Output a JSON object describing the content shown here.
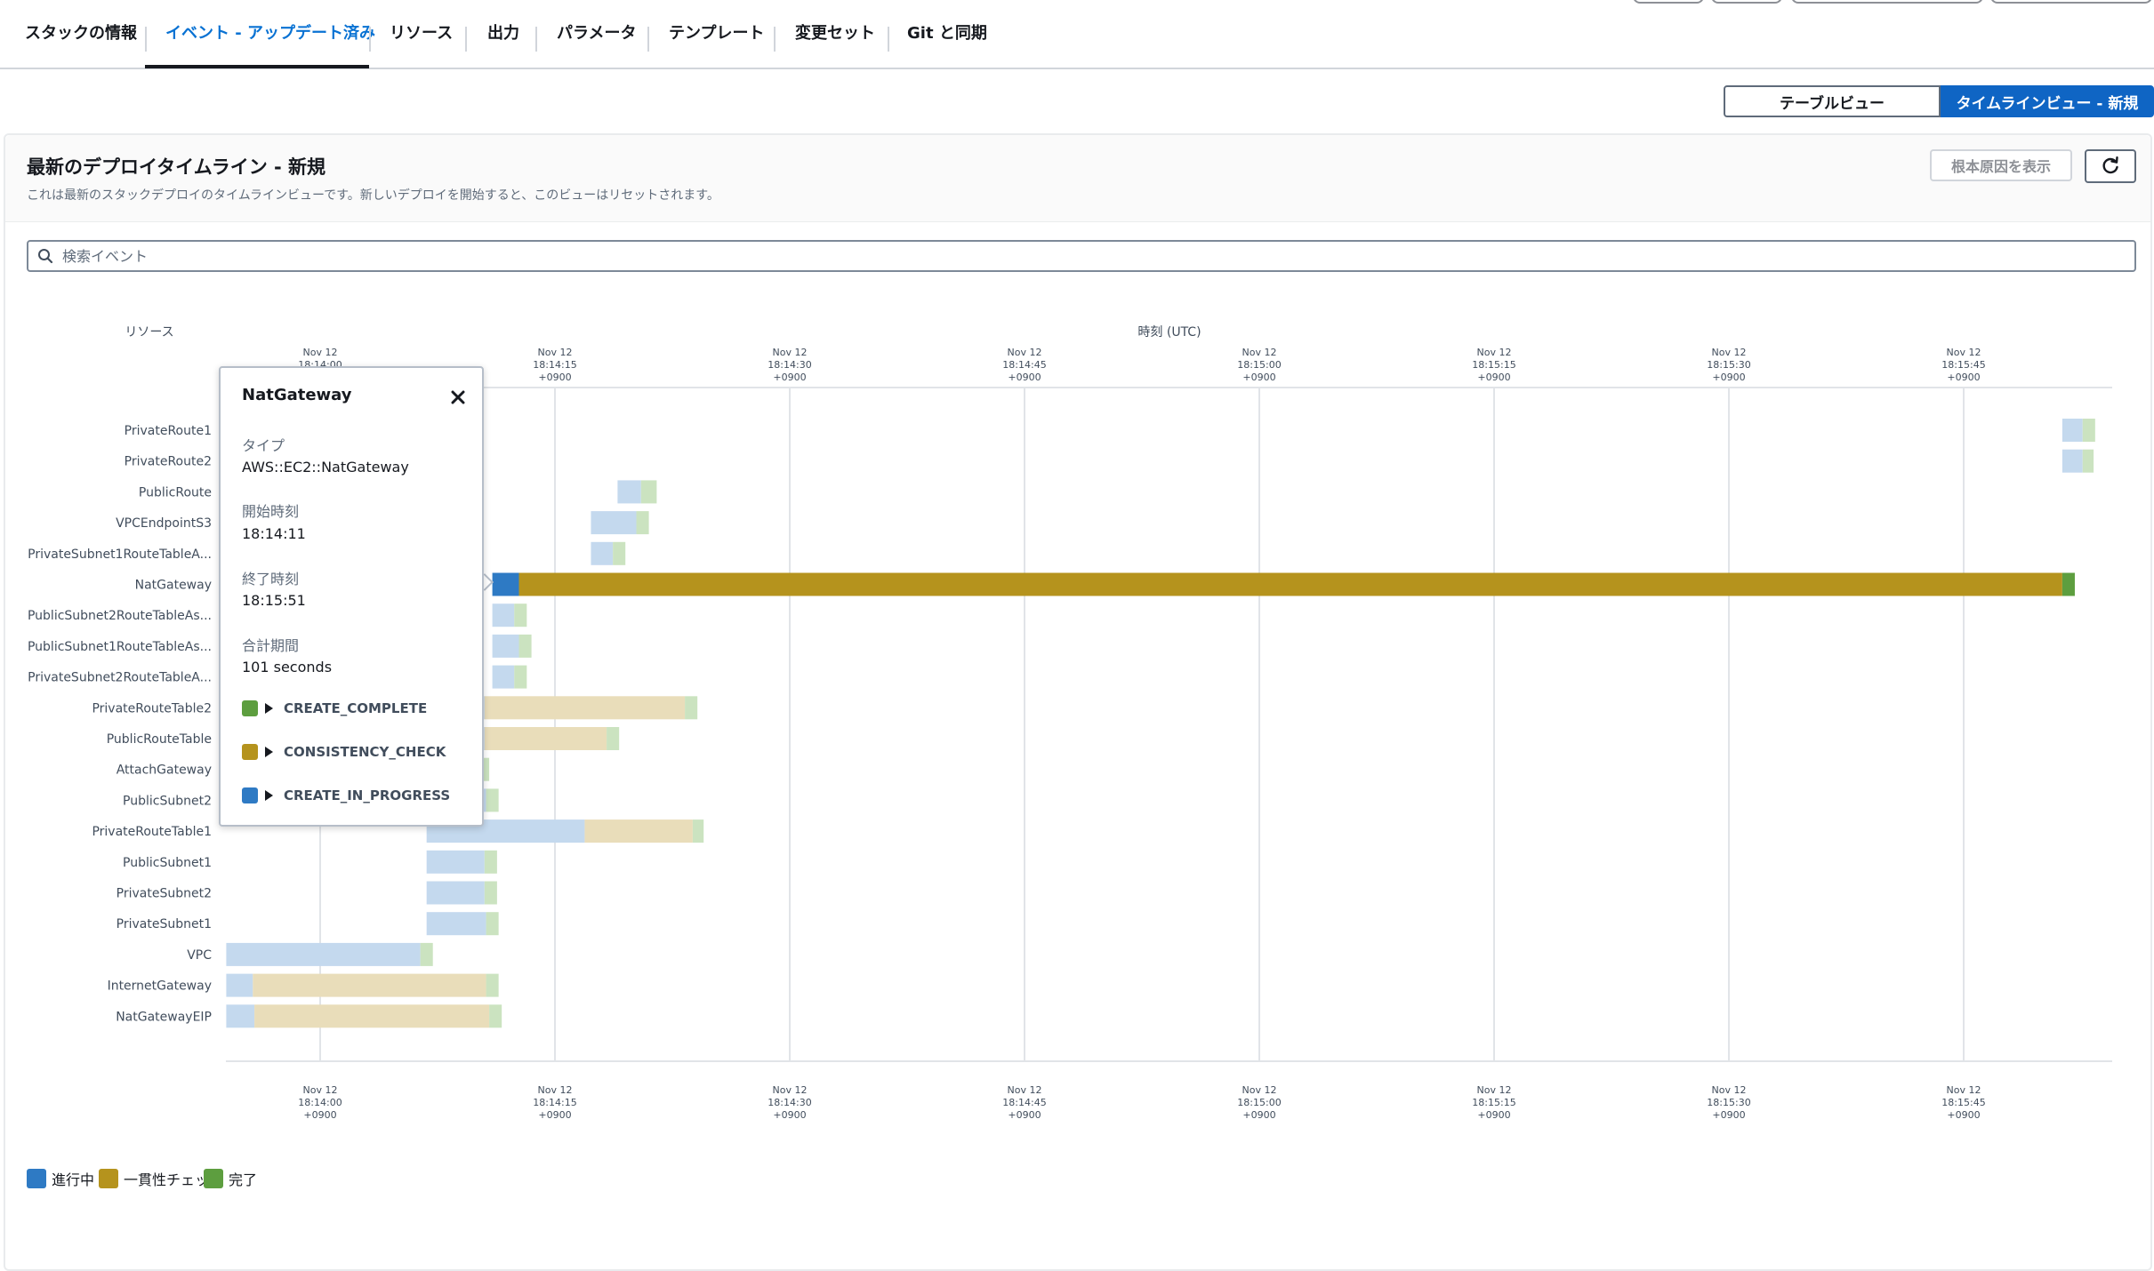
{
  "tabs": [
    {
      "label": "スタックの情報"
    },
    {
      "label": "イベント - アップデート済み",
      "active": true
    },
    {
      "label": "リソース"
    },
    {
      "label": "出力"
    },
    {
      "label": "パラメータ"
    },
    {
      "label": "テンプレート"
    },
    {
      "label": "変更セット"
    },
    {
      "label": "Git と同期"
    }
  ],
  "view_toggle": {
    "table": "テーブルビュー",
    "timeline": "タイムラインビュー - 新規"
  },
  "panel": {
    "title": "最新のデプロイタイムライン - 新規",
    "description": "これは最新のスタックデプロイのタイムラインビューです。新しいデプロイを開始すると、このビューはリセットされます。",
    "root_cause_button": "根本原因を表示",
    "refresh_icon": "refresh-icon"
  },
  "search": {
    "placeholder": "検索イベント",
    "value": "",
    "icon": "search-icon"
  },
  "colors": {
    "in_progress": "#2e7ac4",
    "consistency_check": "#b5931d",
    "complete": "#5d9e3f",
    "in_progress_faded": "#c4d9ee",
    "consistency_check_faded": "#e9ddba",
    "complete_faded": "#cbe3c0"
  },
  "legend": [
    {
      "label": "進行中",
      "color": "#2e7ac4"
    },
    {
      "label": "一貫性チェック",
      "color": "#b5931d"
    },
    {
      "label": "完了",
      "color": "#5d9e3f"
    }
  ],
  "popover": {
    "title": "NatGateway",
    "type_label": "タイプ",
    "type_value": "AWS::EC2::NatGateway",
    "start_label": "開始時刻",
    "start_value": "18:14:11",
    "end_label": "終了時刻",
    "end_value": "18:15:51",
    "duration_label": "合計期間",
    "duration_value": "101 seconds",
    "statuses": [
      {
        "label": "CREATE_COMPLETE",
        "color": "#5d9e3f"
      },
      {
        "label": "CONSISTENCY_CHECK",
        "color": "#b5931d"
      },
      {
        "label": "CREATE_IN_PROGRESS",
        "color": "#2e7ac4"
      }
    ]
  },
  "chart_data": {
    "type": "timeline",
    "ylabel": "リソース",
    "xlabel": "時刻 (UTC)",
    "x_unit": "seconds after 18:14:00 +0900",
    "xlim": [
      -4,
      76.4
    ],
    "ticks": [
      {
        "date": "Nov 12",
        "time": "18:14:00",
        "tz": "+0900",
        "value": 0
      },
      {
        "date": "Nov 12",
        "time": "18:14:15",
        "tz": "+0900",
        "value": 15
      },
      {
        "date": "Nov 12",
        "time": "18:14:30",
        "tz": "+0900",
        "value": 30
      },
      {
        "date": "Nov 12",
        "time": "18:14:45",
        "tz": "+0900",
        "value": 45
      },
      {
        "date": "Nov 12",
        "time": "18:15:00",
        "tz": "+0900",
        "value": 60
      },
      {
        "date": "Nov 12",
        "time": "18:15:15",
        "tz": "+0900",
        "value": 75
      },
      {
        "date": "Nov 12",
        "time": "18:15:30",
        "tz": "+0900",
        "value": 90
      },
      {
        "date": "Nov 12",
        "time": "18:15:45",
        "tz": "+0900",
        "value": 105
      }
    ],
    "highlighted": "NatGateway",
    "resources": [
      {
        "name": "PrivateRoute1",
        "segments": [
          {
            "s": "in_progress",
            "from": 111.3,
            "to": 112.6
          },
          {
            "s": "complete",
            "from": 112.6,
            "to": 113.4
          }
        ]
      },
      {
        "name": "PrivateRoute2",
        "segments": [
          {
            "s": "in_progress",
            "from": 111.3,
            "to": 112.6
          },
          {
            "s": "complete",
            "from": 112.6,
            "to": 113.3
          }
        ]
      },
      {
        "name": "PublicRoute",
        "segments": [
          {
            "s": "in_progress",
            "from": 19.0,
            "to": 20.5
          },
          {
            "s": "complete",
            "from": 20.5,
            "to": 21.5
          }
        ]
      },
      {
        "name": "VPCEndpointS3",
        "segments": [
          {
            "s": "in_progress",
            "from": 17.3,
            "to": 20.2
          },
          {
            "s": "complete",
            "from": 20.2,
            "to": 21.0
          }
        ]
      },
      {
        "name": "PrivateSubnet1RouteTableA...",
        "segments": [
          {
            "s": "in_progress",
            "from": 17.3,
            "to": 18.7
          },
          {
            "s": "complete",
            "from": 18.7,
            "to": 19.5
          }
        ]
      },
      {
        "name": "NatGateway",
        "segments": [
          {
            "s": "in_progress",
            "from": 11.0,
            "to": 12.7
          },
          {
            "s": "consistency_check",
            "from": 12.7,
            "to": 111.3
          },
          {
            "s": "complete",
            "from": 111.3,
            "to": 112.1
          }
        ]
      },
      {
        "name": "PublicSubnet2RouteTableAs...",
        "segments": [
          {
            "s": "in_progress",
            "from": 11.0,
            "to": 12.4
          },
          {
            "s": "complete",
            "from": 12.4,
            "to": 13.2
          }
        ]
      },
      {
        "name": "PublicSubnet1RouteTableAs...",
        "segments": [
          {
            "s": "in_progress",
            "from": 11.0,
            "to": 12.7
          },
          {
            "s": "complete",
            "from": 12.7,
            "to": 13.5
          }
        ]
      },
      {
        "name": "PrivateSubnet2RouteTableA...",
        "segments": [
          {
            "s": "in_progress",
            "from": 11.0,
            "to": 12.4
          },
          {
            "s": "complete",
            "from": 12.4,
            "to": 13.2
          }
        ]
      },
      {
        "name": "PrivateRouteTable2",
        "segments": [
          {
            "s": "in_progress",
            "from": 7.5,
            "to": 10.5
          },
          {
            "s": "consistency_check",
            "from": 10.5,
            "to": 23.3
          },
          {
            "s": "complete",
            "from": 23.3,
            "to": 24.1
          }
        ]
      },
      {
        "name": "PublicRouteTable",
        "segments": [
          {
            "s": "in_progress",
            "from": 7.5,
            "to": 10.5
          },
          {
            "s": "consistency_check",
            "from": 10.5,
            "to": 18.3
          },
          {
            "s": "complete",
            "from": 18.3,
            "to": 19.1
          }
        ]
      },
      {
        "name": "AttachGateway",
        "segments": [
          {
            "s": "in_progress",
            "from": 7.5,
            "to": 10.0
          },
          {
            "s": "complete",
            "from": 10.0,
            "to": 10.8
          }
        ]
      },
      {
        "name": "PublicSubnet2",
        "segments": [
          {
            "s": "in_progress",
            "from": 7.5,
            "to": 10.6
          },
          {
            "s": "complete",
            "from": 10.6,
            "to": 11.4
          }
        ]
      },
      {
        "name": "PrivateRouteTable1",
        "segments": [
          {
            "s": "in_progress",
            "from": 6.8,
            "to": 16.9
          },
          {
            "s": "consistency_check",
            "from": 16.9,
            "to": 23.8
          },
          {
            "s": "complete",
            "from": 23.8,
            "to": 24.5
          }
        ]
      },
      {
        "name": "PublicSubnet1",
        "segments": [
          {
            "s": "in_progress",
            "from": 6.8,
            "to": 10.5
          },
          {
            "s": "complete",
            "from": 10.5,
            "to": 11.3
          }
        ]
      },
      {
        "name": "PrivateSubnet2",
        "segments": [
          {
            "s": "in_progress",
            "from": 6.8,
            "to": 10.5
          },
          {
            "s": "complete",
            "from": 10.5,
            "to": 11.3
          }
        ]
      },
      {
        "name": "PrivateSubnet1",
        "segments": [
          {
            "s": "in_progress",
            "from": 6.8,
            "to": 10.6
          },
          {
            "s": "complete",
            "from": 10.6,
            "to": 11.4
          }
        ]
      },
      {
        "name": "VPC",
        "segments": [
          {
            "s": "in_progress",
            "from": -6.0,
            "to": 6.4
          },
          {
            "s": "complete",
            "from": 6.4,
            "to": 7.2
          }
        ]
      },
      {
        "name": "InternetGateway",
        "segments": [
          {
            "s": "in_progress",
            "from": -6.0,
            "to": -4.3
          },
          {
            "s": "consistency_check",
            "from": -4.3,
            "to": 10.6
          },
          {
            "s": "complete",
            "from": 10.6,
            "to": 11.4
          }
        ]
      },
      {
        "name": "NatGatewayEIP",
        "segments": [
          {
            "s": "in_progress",
            "from": -6.0,
            "to": -4.2
          },
          {
            "s": "consistency_check",
            "from": -4.2,
            "to": 10.8
          },
          {
            "s": "complete",
            "from": 10.8,
            "to": 11.6
          }
        ]
      }
    ]
  }
}
